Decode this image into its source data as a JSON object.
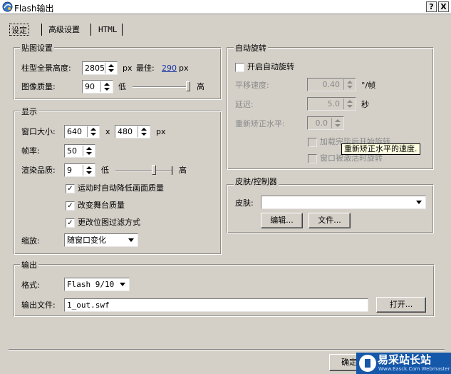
{
  "window": {
    "title": "Flash输出",
    "help_button": "?",
    "close_button": "X"
  },
  "tabs": [
    {
      "label": "设定"
    },
    {
      "label": "高级设置"
    },
    {
      "label": "HTML"
    }
  ],
  "texture": {
    "legend": "贴图设置",
    "panorama_height_label": "柱型全景高度:",
    "panorama_height_value": "2805",
    "px_unit": "px",
    "best_label": "最佳:",
    "best_value": "290",
    "best_unit": "px",
    "quality_label": "图像质量:",
    "quality_value": "90",
    "low_label": "低",
    "high_label": "高",
    "quality_slider_level": 0.97
  },
  "display": {
    "legend": "显示",
    "window_size_label": "窗口大小:",
    "width_value": "640",
    "x_label": "x",
    "height_value": "480",
    "px_unit": "px",
    "framerate_label": "帧率:",
    "framerate_value": "50",
    "render_quality_label": "渲染品质:",
    "render_quality_value": "9",
    "low_label": "低",
    "high_label": "高",
    "render_slider_level": 0.68,
    "checkboxes": [
      {
        "label": "运动时自动降低画面质量",
        "checked": true
      },
      {
        "label": "改变舞台质量",
        "checked": true
      },
      {
        "label": "更改位图过滤方式",
        "checked": true
      }
    ],
    "scale_label": "缩放:",
    "scale_value": "随窗口变化"
  },
  "autorotate": {
    "legend": "自动旋转",
    "enable_label": "开启自动旋转",
    "enable_checked": false,
    "pan_speed_label": "平移速度:",
    "pan_speed_value": "0.40",
    "pan_speed_unit": "°/帧",
    "delay_label": "延迟:",
    "delay_value": "5.0",
    "delay_unit": "秒",
    "relevel_label": "重新矫正水平:",
    "relevel_value": "0.0",
    "after_load_label": "加载完毕后开始旋转",
    "on_activate_label": "窗口被激活时旋转",
    "tooltip": "重新矫正水平的速度."
  },
  "skin": {
    "legend": "皮肤/控制器",
    "skin_label": "皮肤:",
    "skin_value": "",
    "edit_button": "编辑...",
    "file_button": "文件..."
  },
  "output": {
    "legend": "输出",
    "format_label": "格式:",
    "format_value": "Flash 9/10",
    "file_label": "输出文件:",
    "file_value": "1_out.swf",
    "open_button": "打开..."
  },
  "footer": {
    "ok_button": "确定"
  },
  "watermark": {
    "title": "易采站长站",
    "url": "Www.Easck.Com Webmaster"
  },
  "colors": {
    "dialog_bg": "#d4d0c8",
    "link_blue": "#1a37a6",
    "watermark_bg": "#1557a8",
    "tooltip_bg": "#ffffe1"
  }
}
